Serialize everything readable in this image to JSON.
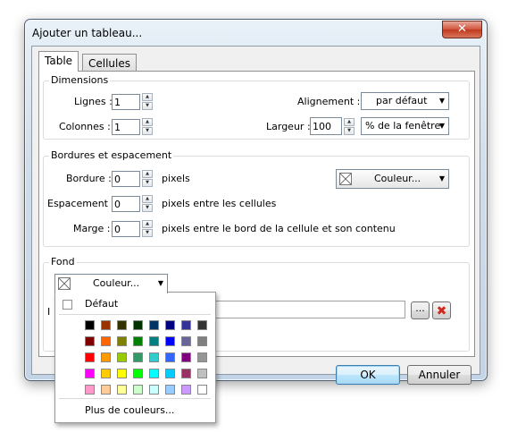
{
  "window": {
    "title": "Ajouter un tableau...",
    "close_glyph": "✕"
  },
  "tabs": [
    {
      "label": "Table"
    },
    {
      "label": "Cellules"
    }
  ],
  "dimensions": {
    "title": "Dimensions",
    "rows_label": "Lignes :",
    "rows_value": "1",
    "cols_label": "Colonnes :",
    "cols_value": "1",
    "align_label": "Alignement :",
    "align_value": "par défaut",
    "width_label": "Largeur :",
    "width_value": "100",
    "width_unit": "% de la fenêtre"
  },
  "borders": {
    "title": "Bordures et espacement",
    "border_label": "Bordure :",
    "border_value": "0",
    "border_unit": "pixels",
    "spacing_label": "Espacement :",
    "spacing_value": "0",
    "spacing_unit": "pixels entre les cellules",
    "margin_label": "Marge :",
    "margin_value": "0",
    "margin_unit": "pixels entre le bord de la cellule et son contenu",
    "color_button": "Couleur..."
  },
  "background": {
    "title": "Fond",
    "color_button": "Couleur...",
    "image_label_partial": "I",
    "browse_button": "...",
    "image_value": ""
  },
  "footer": {
    "ok": "OK",
    "cancel": "Annuler"
  },
  "color_popup": {
    "default_label": "Défaut",
    "more_colors": "Plus de couleurs...",
    "colors": [
      [
        "#000000",
        "#993300",
        "#333300",
        "#003300",
        "#003366",
        "#000080",
        "#333399",
        "#333333"
      ],
      [
        "#800000",
        "#ff6600",
        "#808000",
        "#008000",
        "#008080",
        "#0000ff",
        "#666699",
        "#808080"
      ],
      [
        "#ff0000",
        "#ff9900",
        "#99cc00",
        "#339966",
        "#33cccc",
        "#3366ff",
        "#800080",
        "#969696"
      ],
      [
        "#ff00ff",
        "#ffcc00",
        "#ffff00",
        "#00ff00",
        "#00ffff",
        "#00ccff",
        "#993366",
        "#c0c0c0"
      ],
      [
        "#ff99cc",
        "#ffcc99",
        "#ffff99",
        "#ccffcc",
        "#ccffff",
        "#99ccff",
        "#cc99ff",
        "#ffffff"
      ]
    ]
  }
}
